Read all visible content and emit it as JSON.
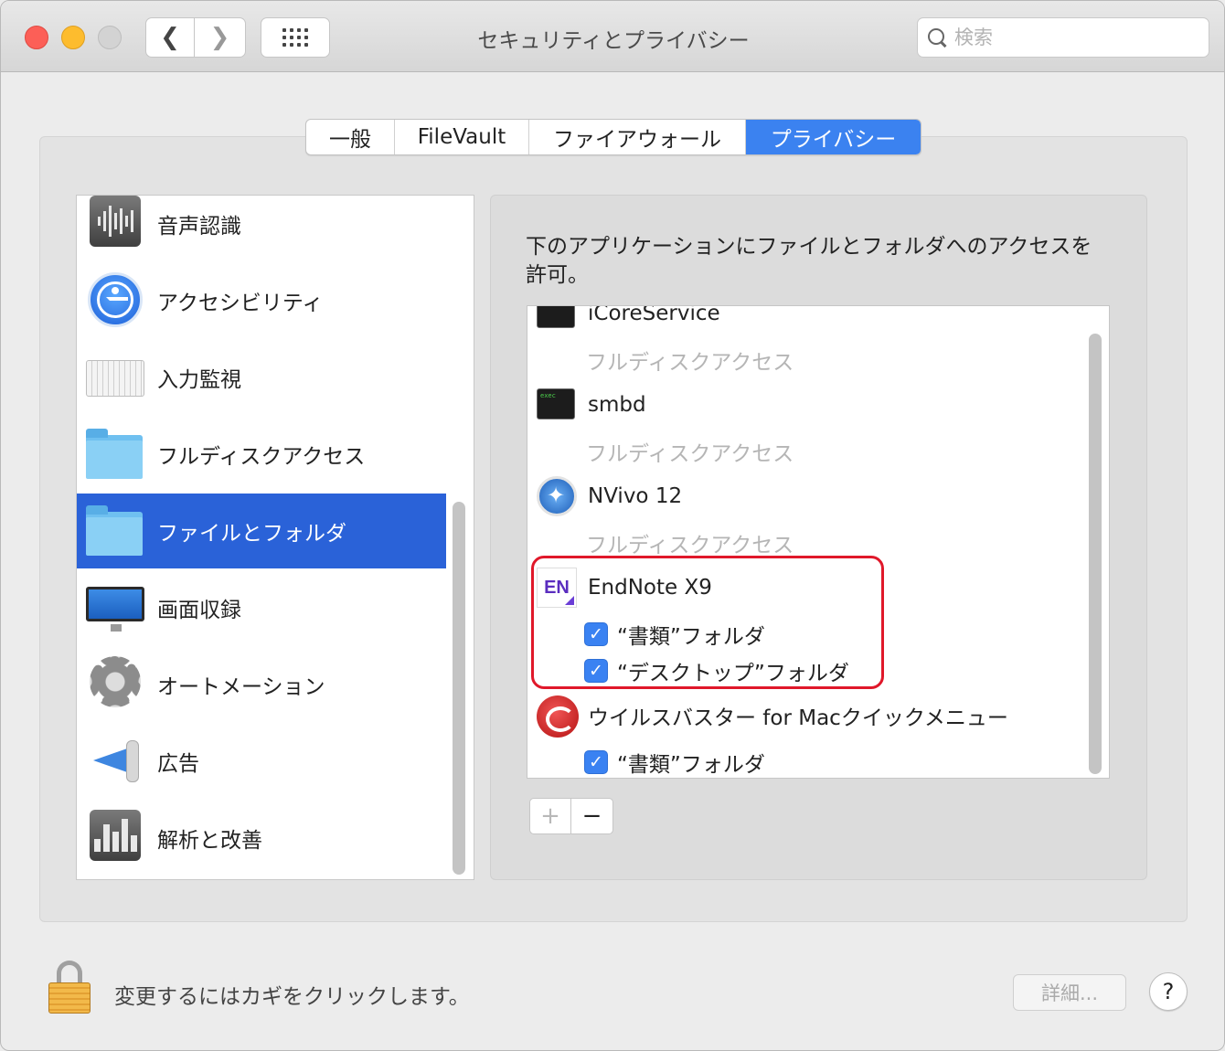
{
  "window": {
    "title": "セキュリティとプライバシー"
  },
  "search": {
    "placeholder": "検索"
  },
  "tabs": [
    {
      "label": "一般",
      "active": false
    },
    {
      "label": "FileVault",
      "active": false
    },
    {
      "label": "ファイアウォール",
      "active": false
    },
    {
      "label": "プライバシー",
      "active": true
    }
  ],
  "categories": [
    {
      "label": "音声認識",
      "icon": "speech-recognition-icon"
    },
    {
      "label": "アクセシビリティ",
      "icon": "accessibility-icon"
    },
    {
      "label": "入力監視",
      "icon": "keyboard-icon"
    },
    {
      "label": "フルディスクアクセス",
      "icon": "folder-icon"
    },
    {
      "label": "ファイルとフォルダ",
      "icon": "folder-icon",
      "selected": true
    },
    {
      "label": "画面収録",
      "icon": "display-icon"
    },
    {
      "label": "オートメーション",
      "icon": "gear-icon"
    },
    {
      "label": "広告",
      "icon": "megaphone-icon"
    },
    {
      "label": "解析と改善",
      "icon": "analytics-icon"
    }
  ],
  "panel": {
    "description": "下のアプリケーションにファイルとフォルダへのアクセスを許可。"
  },
  "apps": [
    {
      "name": "iCoreService",
      "sub": "フルディスクアクセス"
    },
    {
      "name": "smbd",
      "sub": "フルディスクアクセス",
      "icon_text": "exec"
    },
    {
      "name": "NVivo 12",
      "sub": "フルディスクアクセス"
    },
    {
      "name": "EndNote X9",
      "icon_text": "EN",
      "permissions": [
        "“書類”フォルダ",
        "“デスクトップ”フォルダ"
      ]
    },
    {
      "name": "ウイルスバスター for Macクイックメニュー",
      "permissions": [
        "“書類”フォルダ"
      ]
    }
  ],
  "list_buttons": {
    "plus": "+",
    "minus": "−"
  },
  "checkmark": "✓",
  "footer": {
    "lock_text": "変更するにはカギをクリックします。",
    "detail_button": "詳細...",
    "help_button": "?"
  },
  "colors": {
    "accent": "#3b82f0",
    "selection": "#2a62d8",
    "highlight_border": "#e0182a"
  }
}
